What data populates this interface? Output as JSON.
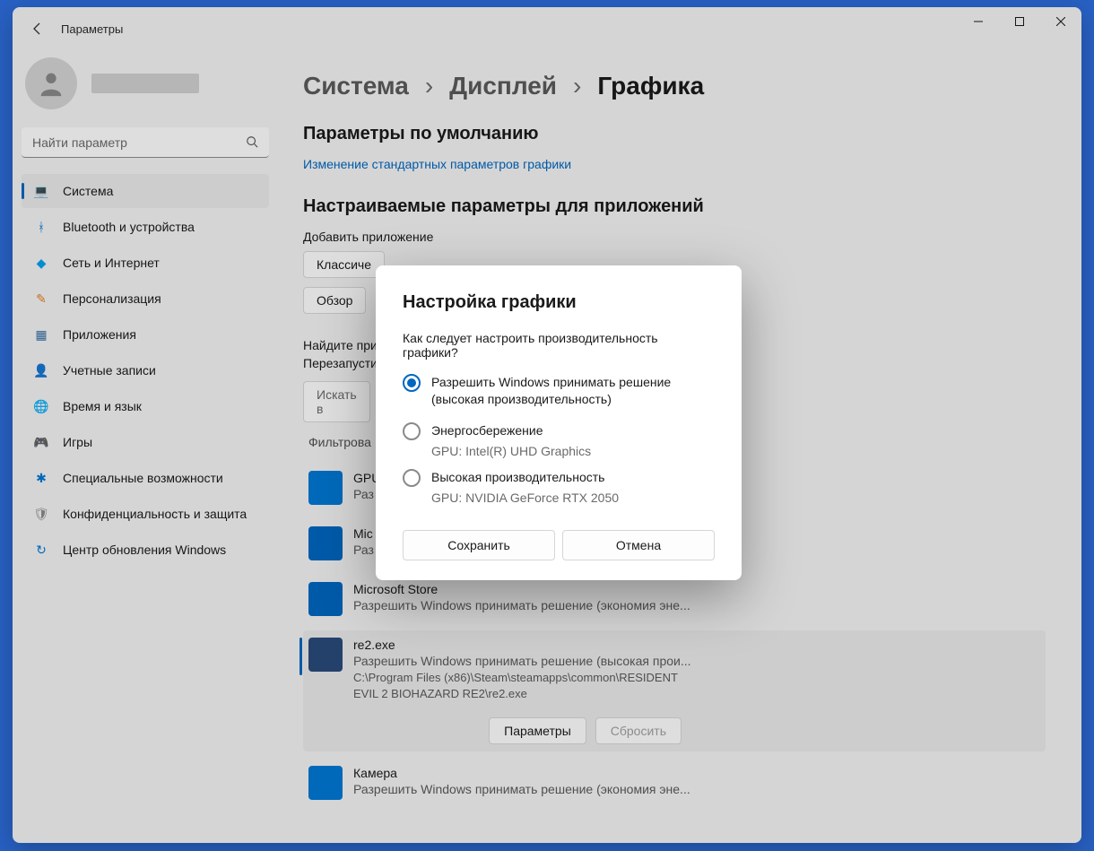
{
  "window": {
    "title": "Параметры"
  },
  "search": {
    "placeholder": "Найти параметр"
  },
  "nav": [
    {
      "key": "system",
      "label": "Система",
      "icon": "💻",
      "color": "#0078d4"
    },
    {
      "key": "bluetooth",
      "label": "Bluetooth и устройства",
      "icon": "ᚼ",
      "color": "#0078d4"
    },
    {
      "key": "network",
      "label": "Сеть и Интернет",
      "icon": "◆",
      "color": "#00a2ed"
    },
    {
      "key": "personalization",
      "label": "Персонализация",
      "icon": "✎",
      "color": "#e67e22"
    },
    {
      "key": "apps",
      "label": "Приложения",
      "icon": "▦",
      "color": "#3a6ea5"
    },
    {
      "key": "accounts",
      "label": "Учетные записи",
      "icon": "👤",
      "color": "#6bb86b"
    },
    {
      "key": "time",
      "label": "Время и язык",
      "icon": "🌐",
      "color": "#3a6ea5"
    },
    {
      "key": "games",
      "label": "Игры",
      "icon": "🎮",
      "color": "#6a6a6a"
    },
    {
      "key": "accessibility",
      "label": "Специальные возможности",
      "icon": "✱",
      "color": "#0078d4"
    },
    {
      "key": "privacy",
      "label": "Конфиденциальность и защита",
      "icon": "🛡",
      "color": "#8a8a8a"
    },
    {
      "key": "update",
      "label": "Центр обновления Windows",
      "icon": "↻",
      "color": "#0078d4"
    }
  ],
  "breadcrumb": {
    "a": "Система",
    "b": "Дисплей",
    "c": "Графика"
  },
  "defaults": {
    "heading": "Параметры по умолчанию",
    "link": "Изменение стандартных параметров графики"
  },
  "custom": {
    "heading": "Настраиваемые параметры для приложений",
    "add_label": "Добавить приложение",
    "dropdown": "Классиче",
    "browse": "Обзор",
    "hint": "Найдите приложение в списке и выберите для него настройки. Перезапустите приложение, чтобы изменения вступили в силу.",
    "search_placeholder": "Искать в",
    "filter": "Фильтрова"
  },
  "apps": [
    {
      "name": "GPU",
      "sub": "Раз",
      "icon_bg": "#0078d4"
    },
    {
      "name": "Mic",
      "sub": "Раз",
      "icon_bg": "#0067c0"
    },
    {
      "name": "Microsoft Store",
      "sub": "Разрешить Windows принимать решение (экономия эне...",
      "icon_bg": "#0067c0"
    },
    {
      "name": "re2.exe",
      "sub": "Разрешить Windows принимать решение (высокая прои...",
      "path": "C:\\Program Files (x86)\\Steam\\steamapps\\common\\RESIDENT EVIL 2  BIOHAZARD RE2\\re2.exe",
      "icon_bg": "#2a4b7c"
    },
    {
      "name": "Камера",
      "sub": "Разрешить Windows принимать решение (экономия эне...",
      "icon_bg": "#0078d4"
    }
  ],
  "item_actions": {
    "options": "Параметры",
    "reset": "Сбросить"
  },
  "modal": {
    "title": "Настройка графики",
    "question": "Как следует настроить производительность графики?",
    "opt1": "Разрешить Windows принимать решение (высокая производительность)",
    "opt2": "Энергосбережение",
    "gpu2": "GPU: Intel(R) UHD Graphics",
    "opt3": "Высокая производительность",
    "gpu3": "GPU: NVIDIA GeForce RTX 2050",
    "save": "Сохранить",
    "cancel": "Отмена"
  }
}
